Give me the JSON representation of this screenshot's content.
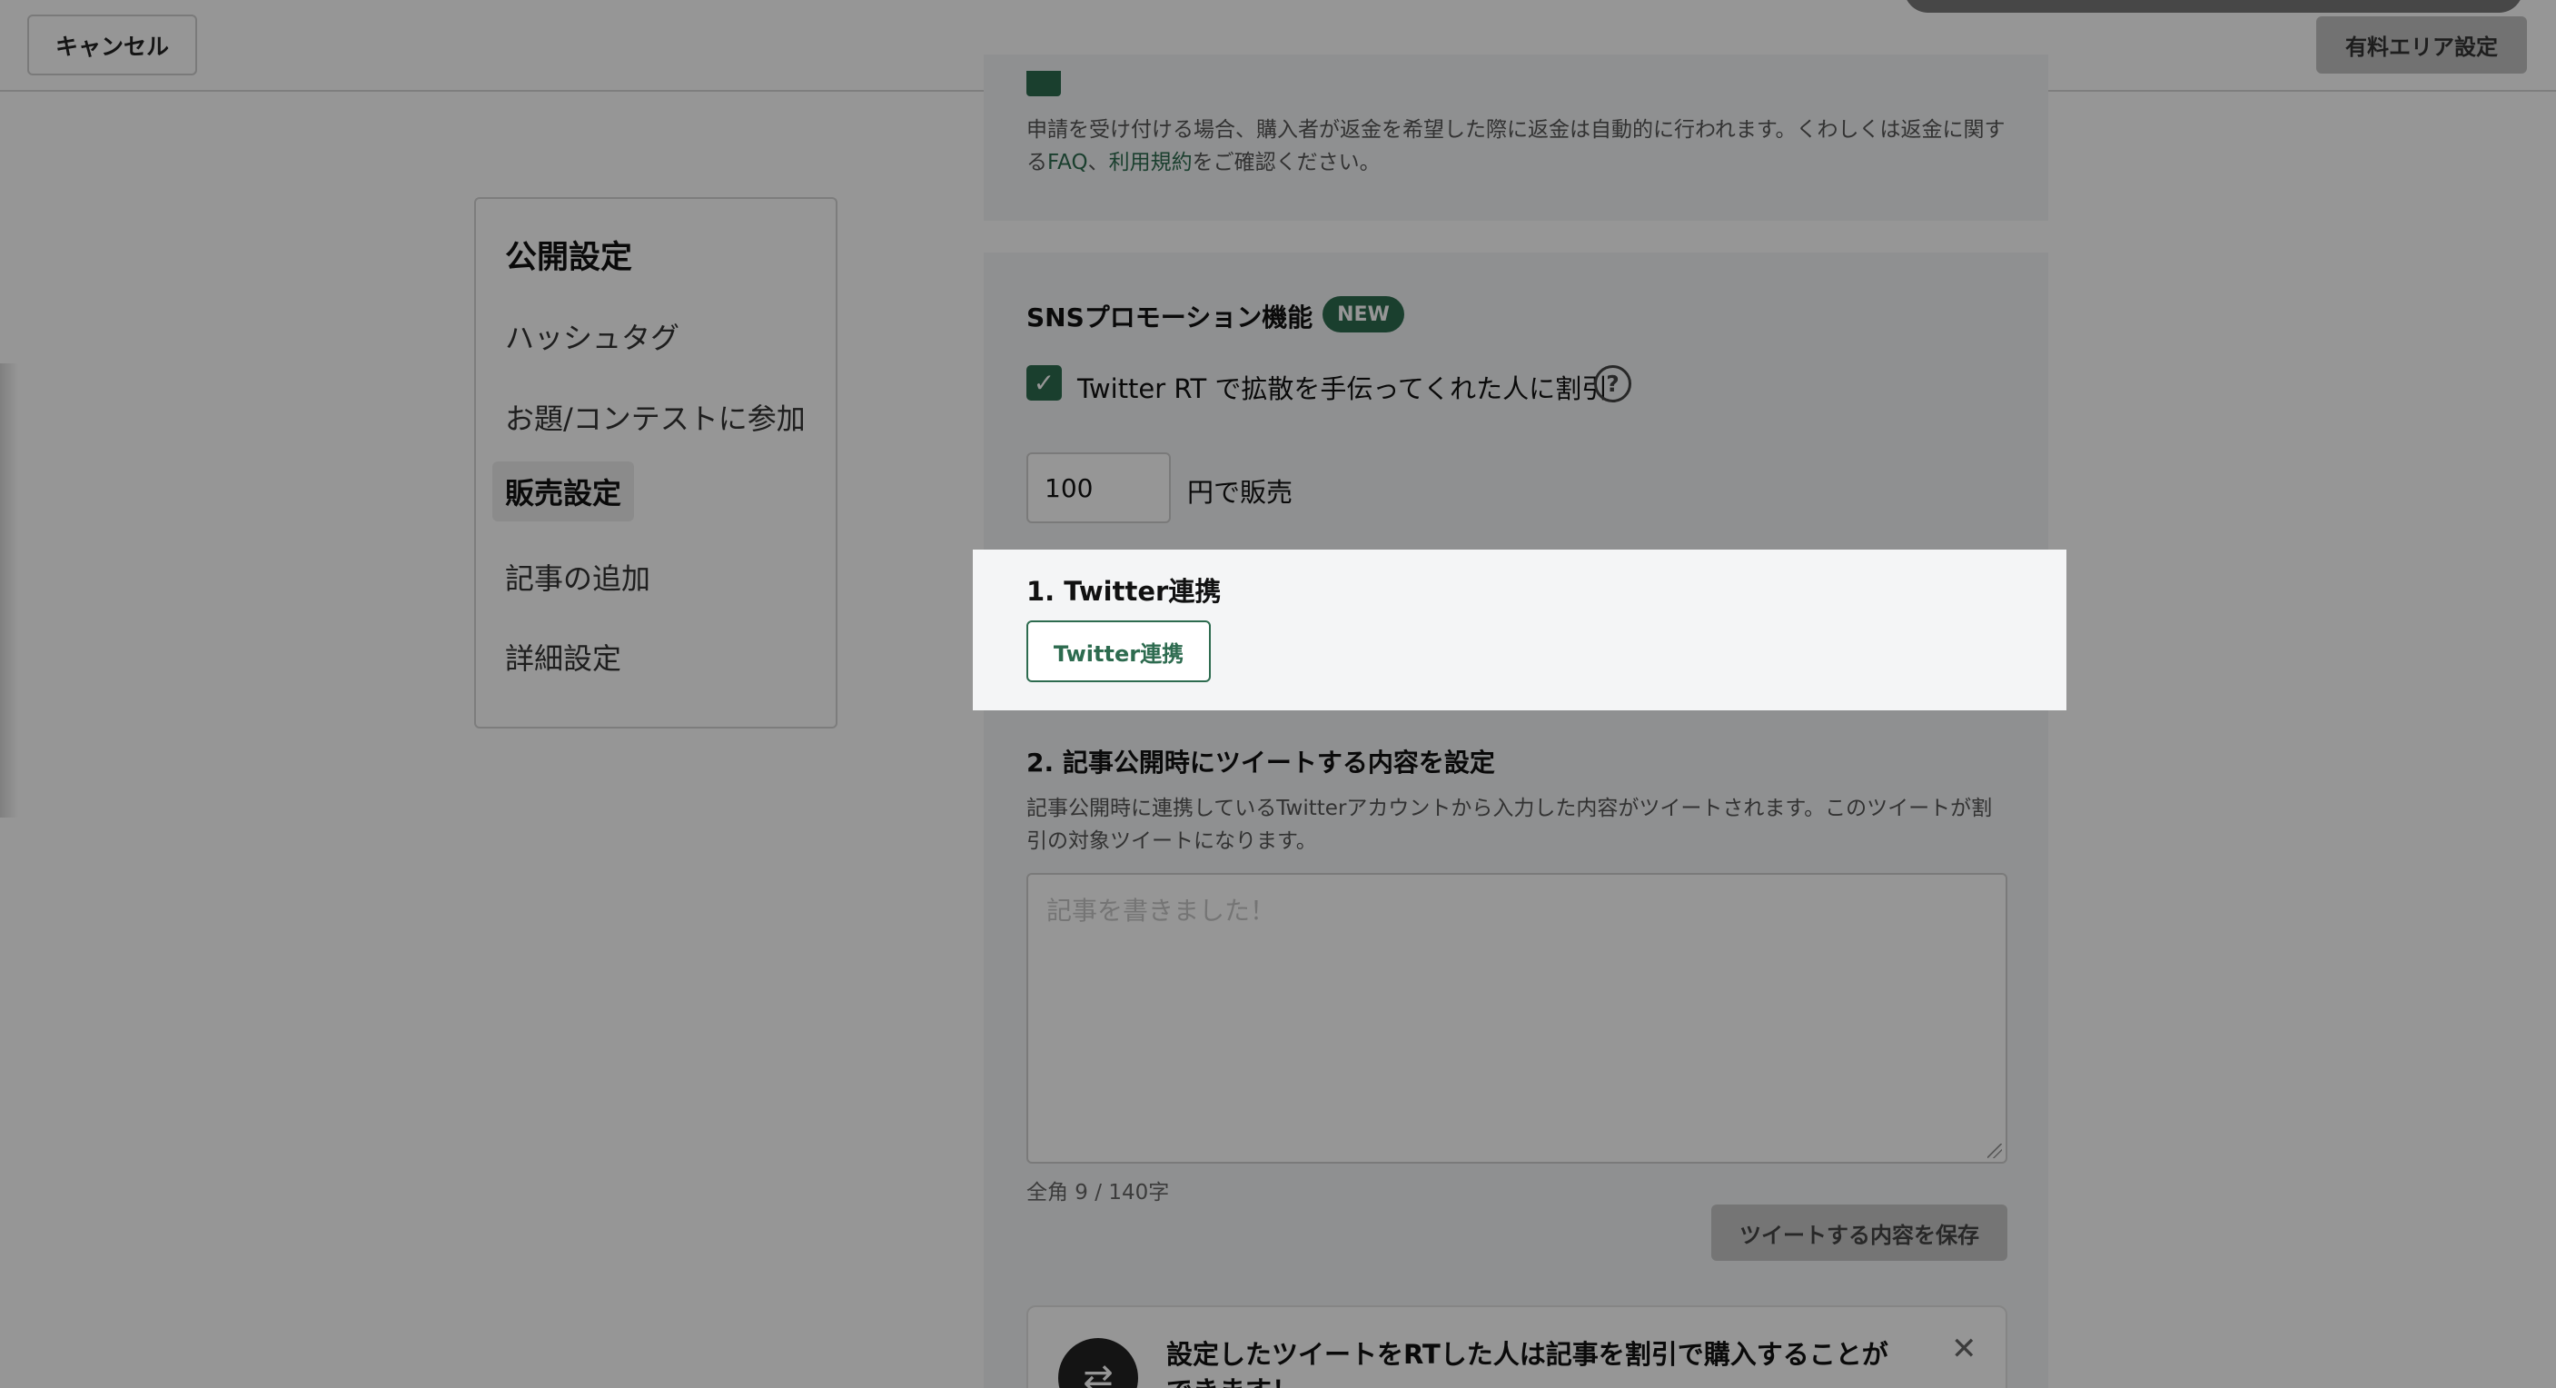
{
  "header": {
    "cancel_label": "キャンセル",
    "paid_area_label": "有料エリア設定"
  },
  "sidebar": {
    "title": "公開設定",
    "items": [
      {
        "label": "ハッシュタグ"
      },
      {
        "label": "お題/コンテストに参加"
      },
      {
        "label": "販売設定",
        "active": true
      },
      {
        "label": "記事の追加"
      },
      {
        "label": "詳細設定"
      }
    ]
  },
  "refund": {
    "note_prefix": "申請を受け付ける場合、購入者が返金を希望した際に返金は自動的に行われます。くわしくは返金に関する",
    "faq_link": "FAQ",
    "separator": "、",
    "terms_link": "利用規約",
    "note_suffix": "をご確認ください。"
  },
  "sns": {
    "title": "SNSプロモーション機能",
    "new_badge": "NEW",
    "checkbox_label": "Twitter RT で拡散を手伝ってくれた人に割引",
    "checkbox_checked": true,
    "price_value": "100",
    "price_suffix": "円で販売",
    "step1_title": "1. Twitter連携",
    "twitter_button": "Twitter連携",
    "step2_title": "2. 記事公開時にツイートする内容を設定",
    "step2_desc": "記事公開時に連携しているTwitterアカウントから入力した内容がツイートされます。このツイートが割引の対象ツイートになります。",
    "tweet_placeholder": "記事を書きました！",
    "char_count": "全角 9 / 140字",
    "save_button": "ツイートする内容を保存",
    "info_text": "設定したツイートをRTした人は記事を割引で購入することができます！"
  },
  "icons": {
    "check": "check-icon",
    "help": "help-circle-icon",
    "retweet": "retweet-icon",
    "close": "close-icon"
  },
  "colors": {
    "accent": "#2d6b4f",
    "overlay": "rgba(0,0,0,0.41)"
  }
}
